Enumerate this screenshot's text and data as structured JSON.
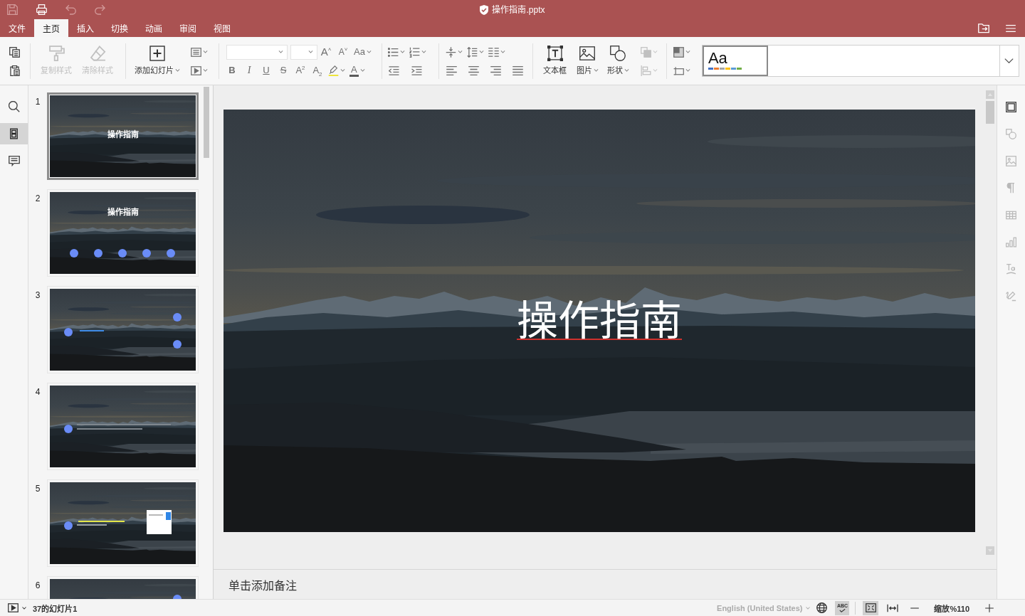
{
  "title_bar": {
    "quick_access": [
      {
        "kind": "save",
        "disabled": true
      },
      {
        "kind": "print",
        "disabled": false
      },
      {
        "kind": "undo",
        "disabled": true
      },
      {
        "kind": "redo",
        "disabled": true
      }
    ],
    "title": "操作指南.pptx"
  },
  "menu": {
    "tabs": [
      {
        "label": "文件",
        "selected": false
      },
      {
        "label": "主页",
        "selected": true
      },
      {
        "label": "插入",
        "selected": false
      },
      {
        "label": "切换",
        "selected": false
      },
      {
        "label": "动画",
        "selected": false
      },
      {
        "label": "审阅",
        "selected": false
      },
      {
        "label": "视图",
        "selected": false
      }
    ]
  },
  "toolbar": {
    "groups": [
      {
        "rows": [
          [
            {
              "kind": "copy",
              "dropdown": false,
              "disabled": false
            }
          ],
          [
            {
              "kind": "paste",
              "dropdown": false,
              "disabled": false
            }
          ]
        ]
      },
      {
        "large": [
          {
            "kind": "format-painter",
            "label": "复制样式",
            "dropdown": false,
            "disabled": true
          },
          {
            "kind": "clear-format",
            "label": "清除样式",
            "dropdown": false,
            "disabled": true
          }
        ]
      },
      {
        "large": [
          {
            "kind": "add-slide",
            "label": "添加幻灯片",
            "dropdown": true,
            "disabled": false
          }
        ],
        "rows": [
          [
            {
              "kind": "layout",
              "dropdown": true,
              "disabled": false
            }
          ],
          [
            {
              "kind": "slideshow",
              "dropdown": true,
              "disabled": false
            }
          ]
        ]
      },
      {
        "rows": [
          [
            {
              "kind": "font-name",
              "dropdown": true,
              "disabled": false
            },
            {
              "kind": "font-size",
              "dropdown": true,
              "disabled": false
            },
            {
              "kind": "grow-font",
              "glyph": "A$^{˄}$",
              "dropdown": false,
              "disabled": false
            },
            {
              "kind": "shrink-font",
              "glyph": "A$^{˅}$",
              "dropdown": false,
              "disabled": false
            },
            {
              "kind": "change-case",
              "glyph": "Aa",
              "dropdown": true,
              "disabled": false
            }
          ],
          [
            {
              "kind": "bold",
              "glyph": "B",
              "dropdown": false,
              "disabled": false
            },
            {
              "kind": "italic",
              "glyph": "I",
              "dropdown": false,
              "disabled": false
            },
            {
              "kind": "underline",
              "glyph": "U",
              "dropdown": false,
              "disabled": false
            },
            {
              "kind": "strikethrough",
              "glyph": "S",
              "dropdown": false,
              "disabled": false
            },
            {
              "kind": "superscript",
              "glyph": "A$^{2}$",
              "dropdown": false,
              "disabled": false
            },
            {
              "kind": "subscript",
              "glyph": "A$_{2}$",
              "dropdown": false,
              "disabled": false
            },
            {
              "kind": "highlight",
              "dropdown": true,
              "disabled": false
            },
            {
              "kind": "font-color",
              "glyph": "A",
              "dropdown": true,
              "disabled": false
            }
          ]
        ]
      },
      {
        "rows": [
          [
            {
              "kind": "bullets",
              "dropdown": true,
              "disabled": false
            },
            {
              "kind": "numbering",
              "dropdown": true,
              "disabled": false
            }
          ],
          [
            {
              "kind": "decrease-indent",
              "dropdown": false,
              "disabled": false
            },
            {
              "kind": "increase-indent",
              "dropdown": false,
              "disabled": false
            }
          ]
        ]
      },
      {
        "rows": [
          [
            {
              "kind": "vertical-align",
              "dropdown": true,
              "disabled": false
            },
            {
              "kind": "line-spacing",
              "dropdown": true,
              "disabled": false
            },
            {
              "kind": "columns",
              "dropdown": true,
              "disabled": false
            }
          ],
          [
            {
              "kind": "align-left",
              "dropdown": false,
              "disabled": false
            },
            {
              "kind": "align-center",
              "dropdown": false,
              "disabled": false
            },
            {
              "kind": "align-right",
              "dropdown": false,
              "disabled": false
            },
            {
              "kind": "justify",
              "dropdown": false,
              "disabled": false
            }
          ]
        ]
      },
      {
        "large": [
          {
            "kind": "textbox",
            "label": "文本框",
            "dropdown": false,
            "disabled": false
          },
          {
            "kind": "picture",
            "label": "图片",
            "dropdown": true,
            "disabled": false
          },
          {
            "kind": "shape",
            "label": "形状",
            "dropdown": true,
            "disabled": false
          }
        ],
        "rows": [
          [
            {
              "kind": "arrange",
              "dropdown": true,
              "disabled": true
            }
          ],
          [
            {
              "kind": "align-objects",
              "dropdown": true,
              "disabled": true
            }
          ]
        ]
      },
      {
        "rows": [
          [
            {
              "kind": "background",
              "dropdown": true,
              "disabled": false
            }
          ],
          [
            {
              "kind": "slide-size",
              "dropdown": true,
              "disabled": false
            }
          ]
        ]
      }
    ],
    "themes": {
      "items": [
        {
          "label": "Aa",
          "selected": true,
          "swatches": [
            {
              "color": "#4472c4"
            },
            {
              "color": "#ed7d31"
            },
            {
              "color": "#a5a5a5"
            },
            {
              "color": "#ffc000"
            },
            {
              "color": "#5b9bd5"
            },
            {
              "color": "#70ad47"
            }
          ]
        }
      ]
    }
  },
  "left_rail": {
    "items": [
      {
        "kind": "search",
        "selected": false
      },
      {
        "kind": "slides",
        "selected": true
      },
      {
        "kind": "comments",
        "selected": false
      }
    ]
  },
  "slides_panel": {
    "slides": [
      {
        "number": "1",
        "kind": "title",
        "title": "操作指南",
        "selected": true
      },
      {
        "number": "2",
        "kind": "agenda",
        "title": "操作指南",
        "selected": false
      },
      {
        "number": "3",
        "kind": "points",
        "selected": false
      },
      {
        "number": "4",
        "kind": "bullet",
        "selected": false
      },
      {
        "number": "5",
        "kind": "callout",
        "selected": false
      },
      {
        "number": "6",
        "kind": "side-dot",
        "selected": false
      }
    ]
  },
  "editor": {
    "slide": {
      "title": "操作指南",
      "spelling_error": true
    },
    "notes": {
      "placeholder": "单击添加备注"
    }
  },
  "right_rail": {
    "items": [
      {
        "kind": "slide-settings",
        "disabled": false
      },
      {
        "kind": "shape-settings",
        "disabled": true
      },
      {
        "kind": "image-settings",
        "disabled": true
      },
      {
        "kind": "paragraph-settings",
        "disabled": true
      },
      {
        "kind": "table-settings",
        "disabled": true
      },
      {
        "kind": "chart-settings",
        "disabled": true
      },
      {
        "kind": "text-art-settings",
        "disabled": true
      },
      {
        "kind": "signature-settings",
        "disabled": true
      }
    ]
  },
  "status_bar": {
    "slide_counter": "37的幻灯片1",
    "language": {
      "label": "English (United States)",
      "disabled": true
    },
    "spell_check": {
      "glyph": "ABC",
      "on": true
    },
    "fit_slide": {
      "on": true
    },
    "fit_width": {
      "on": false
    },
    "zoom": "缩放%110"
  }
}
